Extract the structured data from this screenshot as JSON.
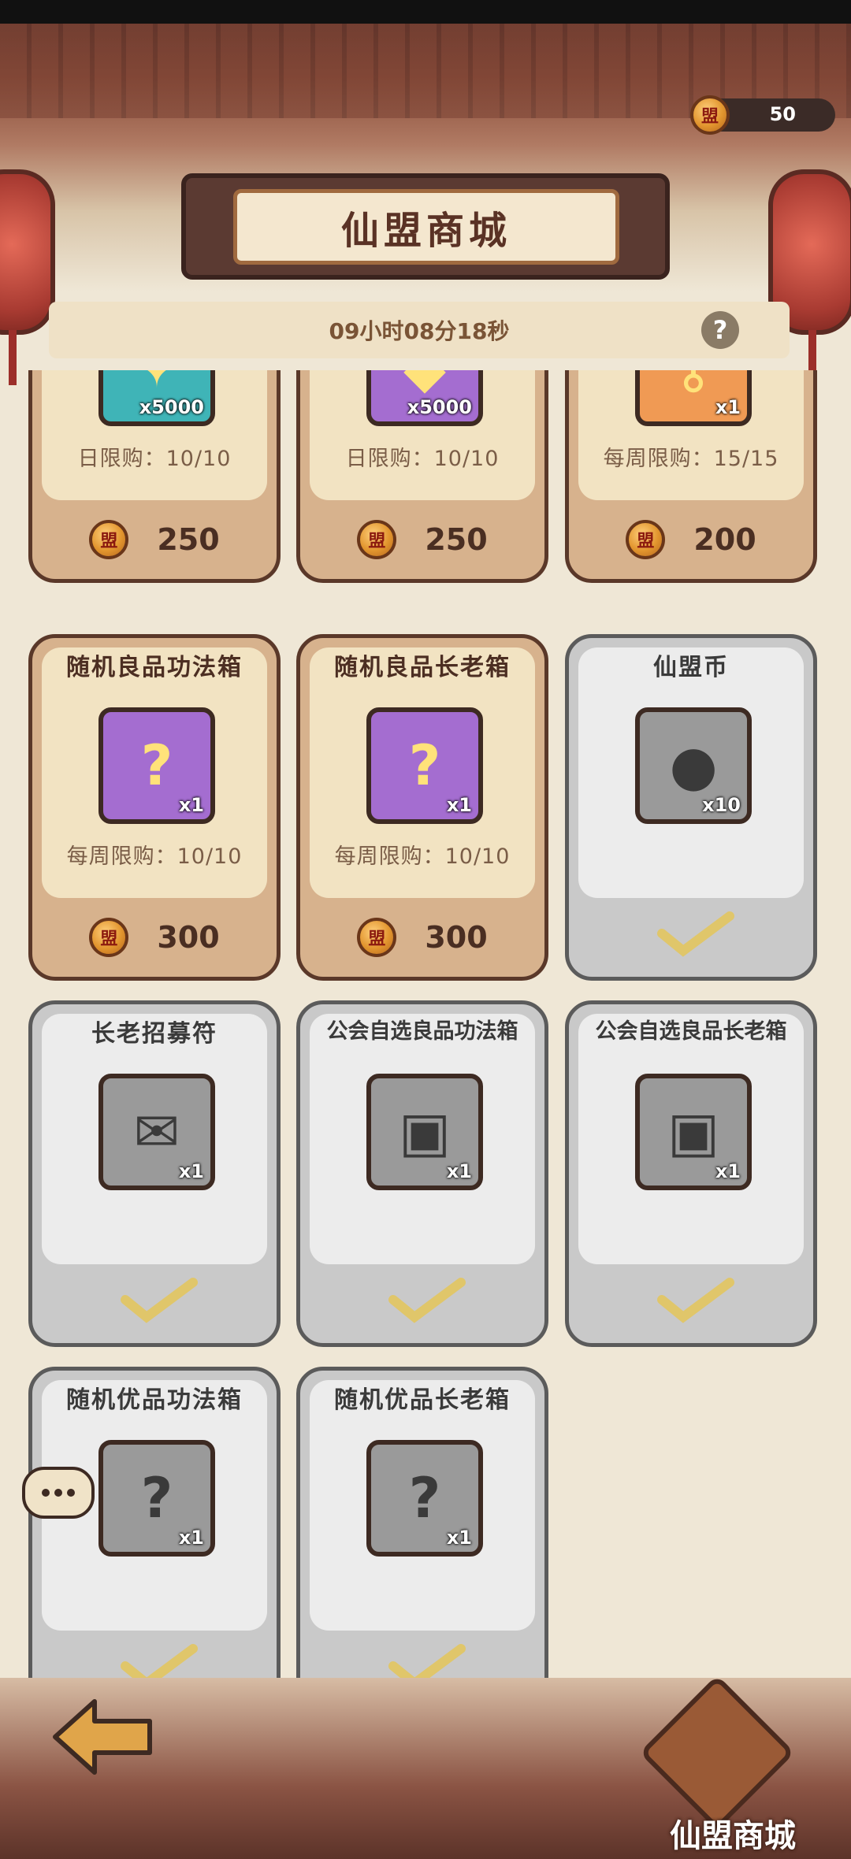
{
  "header": {
    "title": "仙盟商城",
    "currency_value": "50",
    "timer": "09小时08分18秒",
    "help_label": "?"
  },
  "items": [
    {
      "name": "",
      "qty": "x5000",
      "limit": "日限购：10/10",
      "price": "250",
      "color": "#3fb4b7",
      "sold": false,
      "glyph": "✦"
    },
    {
      "name": "",
      "qty": "x5000",
      "limit": "日限购：10/10",
      "price": "250",
      "color": "#a46dd0",
      "sold": false,
      "glyph": "◆"
    },
    {
      "name": "",
      "qty": "x1",
      "limit": "每周限购：15/15",
      "price": "200",
      "color": "#f09a54",
      "sold": false,
      "glyph": "⚷"
    },
    {
      "name": "随机良品功法箱",
      "qty": "x1",
      "limit": "每周限购：10/10",
      "price": "300",
      "color": "#a46dd0",
      "sold": false,
      "glyph": "?"
    },
    {
      "name": "随机良品长老箱",
      "qty": "x1",
      "limit": "每周限购：10/10",
      "price": "300",
      "color": "#a46dd0",
      "sold": false,
      "glyph": "?"
    },
    {
      "name": "仙盟币",
      "qty": "x10",
      "limit": "",
      "price": "",
      "color": "#9a9a9a",
      "sold": true,
      "glyph": "●"
    },
    {
      "name": "长老招募符",
      "qty": "x1",
      "limit": "",
      "price": "",
      "color": "#9a9a9a",
      "sold": true,
      "glyph": "✉"
    },
    {
      "name": "公会自选良品功法箱",
      "qty": "x1",
      "limit": "",
      "price": "",
      "color": "#9a9a9a",
      "sold": true,
      "glyph": "▣"
    },
    {
      "name": "公会自选良品长老箱",
      "qty": "x1",
      "limit": "",
      "price": "",
      "color": "#9a9a9a",
      "sold": true,
      "glyph": "▣"
    },
    {
      "name": "随机优品功法箱",
      "qty": "x1",
      "limit": "",
      "price": "",
      "color": "#9a9a9a",
      "sold": true,
      "glyph": "?"
    },
    {
      "name": "随机优品长老箱",
      "qty": "x1",
      "limit": "",
      "price": "",
      "color": "#9a9a9a",
      "sold": true,
      "glyph": "?"
    }
  ],
  "footer": {
    "shop_label": "仙盟商城"
  }
}
